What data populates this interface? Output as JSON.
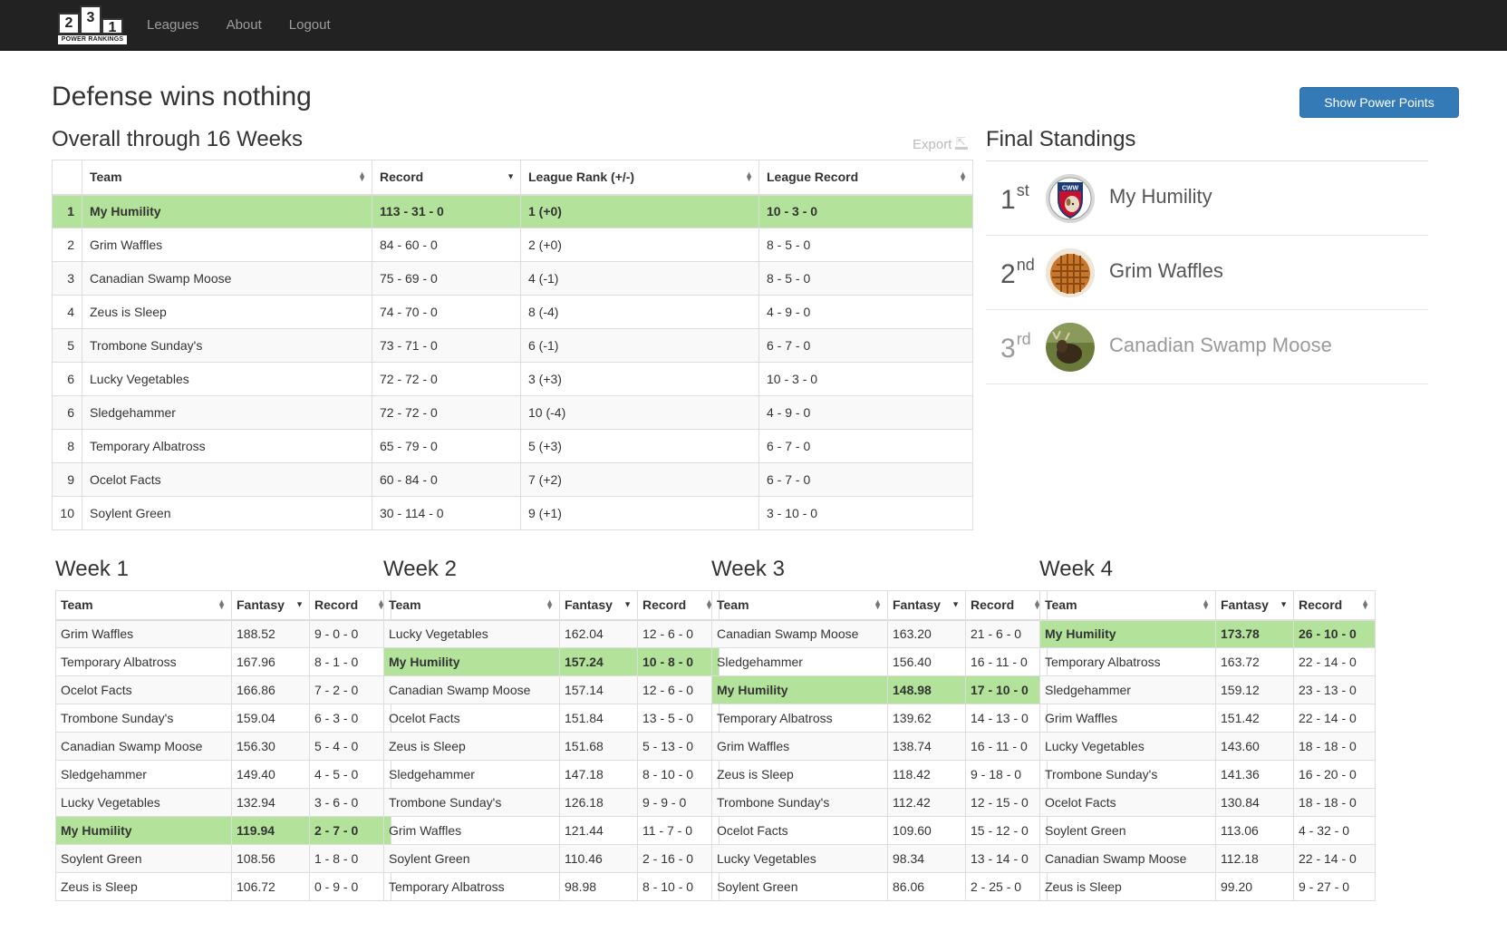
{
  "nav": {
    "logo": {
      "box2": "2",
      "box3": "3",
      "box1": "1",
      "subtitle": "POWER RANKINGS"
    },
    "links": [
      "Leagues",
      "About",
      "Logout"
    ]
  },
  "page": {
    "title": "Defense wins nothing",
    "power_button": "Show Power Points"
  },
  "overall": {
    "title": "Overall through 16 Weeks",
    "export_label": "Export",
    "columns": [
      "",
      "Team",
      "Record",
      "League Rank (+/-)",
      "League Record"
    ],
    "rows": [
      {
        "rank": "1",
        "team": "My Humility",
        "record": "113 - 31 - 0",
        "league_rank": "1 (+0)",
        "league_record": "10 - 3 - 0",
        "highlight": true
      },
      {
        "rank": "2",
        "team": "Grim Waffles",
        "record": "84 - 60 - 0",
        "league_rank": "2 (+0)",
        "league_record": "8 - 5 - 0"
      },
      {
        "rank": "3",
        "team": "Canadian Swamp Moose",
        "record": "75 - 69 - 0",
        "league_rank": "4 (-1)",
        "league_record": "8 - 5 - 0"
      },
      {
        "rank": "4",
        "team": "Zeus is Sleep",
        "record": "74 - 70 - 0",
        "league_rank": "8 (-4)",
        "league_record": "4 - 9 - 0"
      },
      {
        "rank": "5",
        "team": "Trombone Sunday's",
        "record": "73 - 71 - 0",
        "league_rank": "6 (-1)",
        "league_record": "6 - 7 - 0"
      },
      {
        "rank": "6",
        "team": "Lucky Vegetables",
        "record": "72 - 72 - 0",
        "league_rank": "3 (+3)",
        "league_record": "10 - 3 - 0"
      },
      {
        "rank": "6",
        "team": "Sledgehammer",
        "record": "72 - 72 - 0",
        "league_rank": "10 (-4)",
        "league_record": "4 - 9 - 0"
      },
      {
        "rank": "8",
        "team": "Temporary Albatross",
        "record": "65 - 79 - 0",
        "league_rank": "5 (+3)",
        "league_record": "6 - 7 - 0"
      },
      {
        "rank": "9",
        "team": "Ocelot Facts",
        "record": "60 - 84 - 0",
        "league_rank": "7 (+2)",
        "league_record": "6 - 7 - 0"
      },
      {
        "rank": "10",
        "team": "Soylent Green",
        "record": "30 - 114 - 0",
        "league_rank": "9 (+1)",
        "league_record": "3 - 10 - 0"
      }
    ]
  },
  "final_standings": {
    "title": "Final Standings",
    "items": [
      {
        "place": "1",
        "suffix": "st",
        "team": "My Humility",
        "avatar_icon": "cww-shield-dog-avatar"
      },
      {
        "place": "2",
        "suffix": "nd",
        "team": "Grim Waffles",
        "avatar_icon": "waffle-avatar"
      },
      {
        "place": "3",
        "suffix": "rd",
        "team": "Canadian Swamp Moose",
        "avatar_icon": "moose-avatar"
      }
    ]
  },
  "weeks": [
    {
      "title": "Week 1",
      "columns": [
        "Team",
        "Fantasy",
        "Record"
      ],
      "rows": [
        {
          "team": "Grim Waffles",
          "fantasy": "188.52",
          "record": "9 - 0 - 0"
        },
        {
          "team": "Temporary Albatross",
          "fantasy": "167.96",
          "record": "8 - 1 - 0"
        },
        {
          "team": "Ocelot Facts",
          "fantasy": "166.86",
          "record": "7 - 2 - 0"
        },
        {
          "team": "Trombone Sunday's",
          "fantasy": "159.04",
          "record": "6 - 3 - 0"
        },
        {
          "team": "Canadian Swamp Moose",
          "fantasy": "156.30",
          "record": "5 - 4 - 0"
        },
        {
          "team": "Sledgehammer",
          "fantasy": "149.40",
          "record": "4 - 5 - 0"
        },
        {
          "team": "Lucky Vegetables",
          "fantasy": "132.94",
          "record": "3 - 6 - 0"
        },
        {
          "team": "My Humility",
          "fantasy": "119.94",
          "record": "2 - 7 - 0",
          "highlight": true
        },
        {
          "team": "Soylent Green",
          "fantasy": "108.56",
          "record": "1 - 8 - 0"
        },
        {
          "team": "Zeus is Sleep",
          "fantasy": "106.72",
          "record": "0 - 9 - 0"
        }
      ]
    },
    {
      "title": "Week 2",
      "columns": [
        "Team",
        "Fantasy",
        "Record"
      ],
      "rows": [
        {
          "team": "Lucky Vegetables",
          "fantasy": "162.04",
          "record": "12 - 6 - 0"
        },
        {
          "team": "My Humility",
          "fantasy": "157.24",
          "record": "10 - 8 - 0",
          "highlight": true
        },
        {
          "team": "Canadian Swamp Moose",
          "fantasy": "157.14",
          "record": "12 - 6 - 0"
        },
        {
          "team": "Ocelot Facts",
          "fantasy": "151.84",
          "record": "13 - 5 - 0"
        },
        {
          "team": "Zeus is Sleep",
          "fantasy": "151.68",
          "record": "5 - 13 - 0"
        },
        {
          "team": "Sledgehammer",
          "fantasy": "147.18",
          "record": "8 - 10 - 0"
        },
        {
          "team": "Trombone Sunday's",
          "fantasy": "126.18",
          "record": "9 - 9 - 0"
        },
        {
          "team": "Grim Waffles",
          "fantasy": "121.44",
          "record": "11 - 7 - 0"
        },
        {
          "team": "Soylent Green",
          "fantasy": "110.46",
          "record": "2 - 16 - 0"
        },
        {
          "team": "Temporary Albatross",
          "fantasy": "98.98",
          "record": "8 - 10 - 0"
        }
      ]
    },
    {
      "title": "Week 3",
      "columns": [
        "Team",
        "Fantasy",
        "Record"
      ],
      "rows": [
        {
          "team": "Canadian Swamp Moose",
          "fantasy": "163.20",
          "record": "21 - 6 - 0"
        },
        {
          "team": "Sledgehammer",
          "fantasy": "156.40",
          "record": "16 - 11 - 0"
        },
        {
          "team": "My Humility",
          "fantasy": "148.98",
          "record": "17 - 10 - 0",
          "highlight": true
        },
        {
          "team": "Temporary Albatross",
          "fantasy": "139.62",
          "record": "14 - 13 - 0"
        },
        {
          "team": "Grim Waffles",
          "fantasy": "138.74",
          "record": "16 - 11 - 0"
        },
        {
          "team": "Zeus is Sleep",
          "fantasy": "118.42",
          "record": "9 - 18 - 0"
        },
        {
          "team": "Trombone Sunday's",
          "fantasy": "112.42",
          "record": "12 - 15 - 0"
        },
        {
          "team": "Ocelot Facts",
          "fantasy": "109.60",
          "record": "15 - 12 - 0"
        },
        {
          "team": "Lucky Vegetables",
          "fantasy": "98.34",
          "record": "13 - 14 - 0"
        },
        {
          "team": "Soylent Green",
          "fantasy": "86.06",
          "record": "2 - 25 - 0"
        }
      ]
    },
    {
      "title": "Week 4",
      "columns": [
        "Team",
        "Fantasy",
        "Record"
      ],
      "rows": [
        {
          "team": "My Humility",
          "fantasy": "173.78",
          "record": "26 - 10 - 0",
          "highlight": true
        },
        {
          "team": "Temporary Albatross",
          "fantasy": "163.72",
          "record": "22 - 14 - 0"
        },
        {
          "team": "Sledgehammer",
          "fantasy": "159.12",
          "record": "23 - 13 - 0"
        },
        {
          "team": "Grim Waffles",
          "fantasy": "151.42",
          "record": "22 - 14 - 0"
        },
        {
          "team": "Lucky Vegetables",
          "fantasy": "143.60",
          "record": "18 - 18 - 0"
        },
        {
          "team": "Trombone Sunday's",
          "fantasy": "141.36",
          "record": "16 - 20 - 0"
        },
        {
          "team": "Ocelot Facts",
          "fantasy": "130.84",
          "record": "18 - 18 - 0"
        },
        {
          "team": "Soylent Green",
          "fantasy": "113.06",
          "record": "4 - 32 - 0"
        },
        {
          "team": "Canadian Swamp Moose",
          "fantasy": "112.18",
          "record": "22 - 14 - 0"
        },
        {
          "team": "Zeus is Sleep",
          "fantasy": "99.20",
          "record": "9 - 27 - 0"
        }
      ]
    }
  ],
  "colors": {
    "navbar_bg": "#222222",
    "highlight_row": "#b3e39a",
    "primary_button": "#337ab7"
  }
}
